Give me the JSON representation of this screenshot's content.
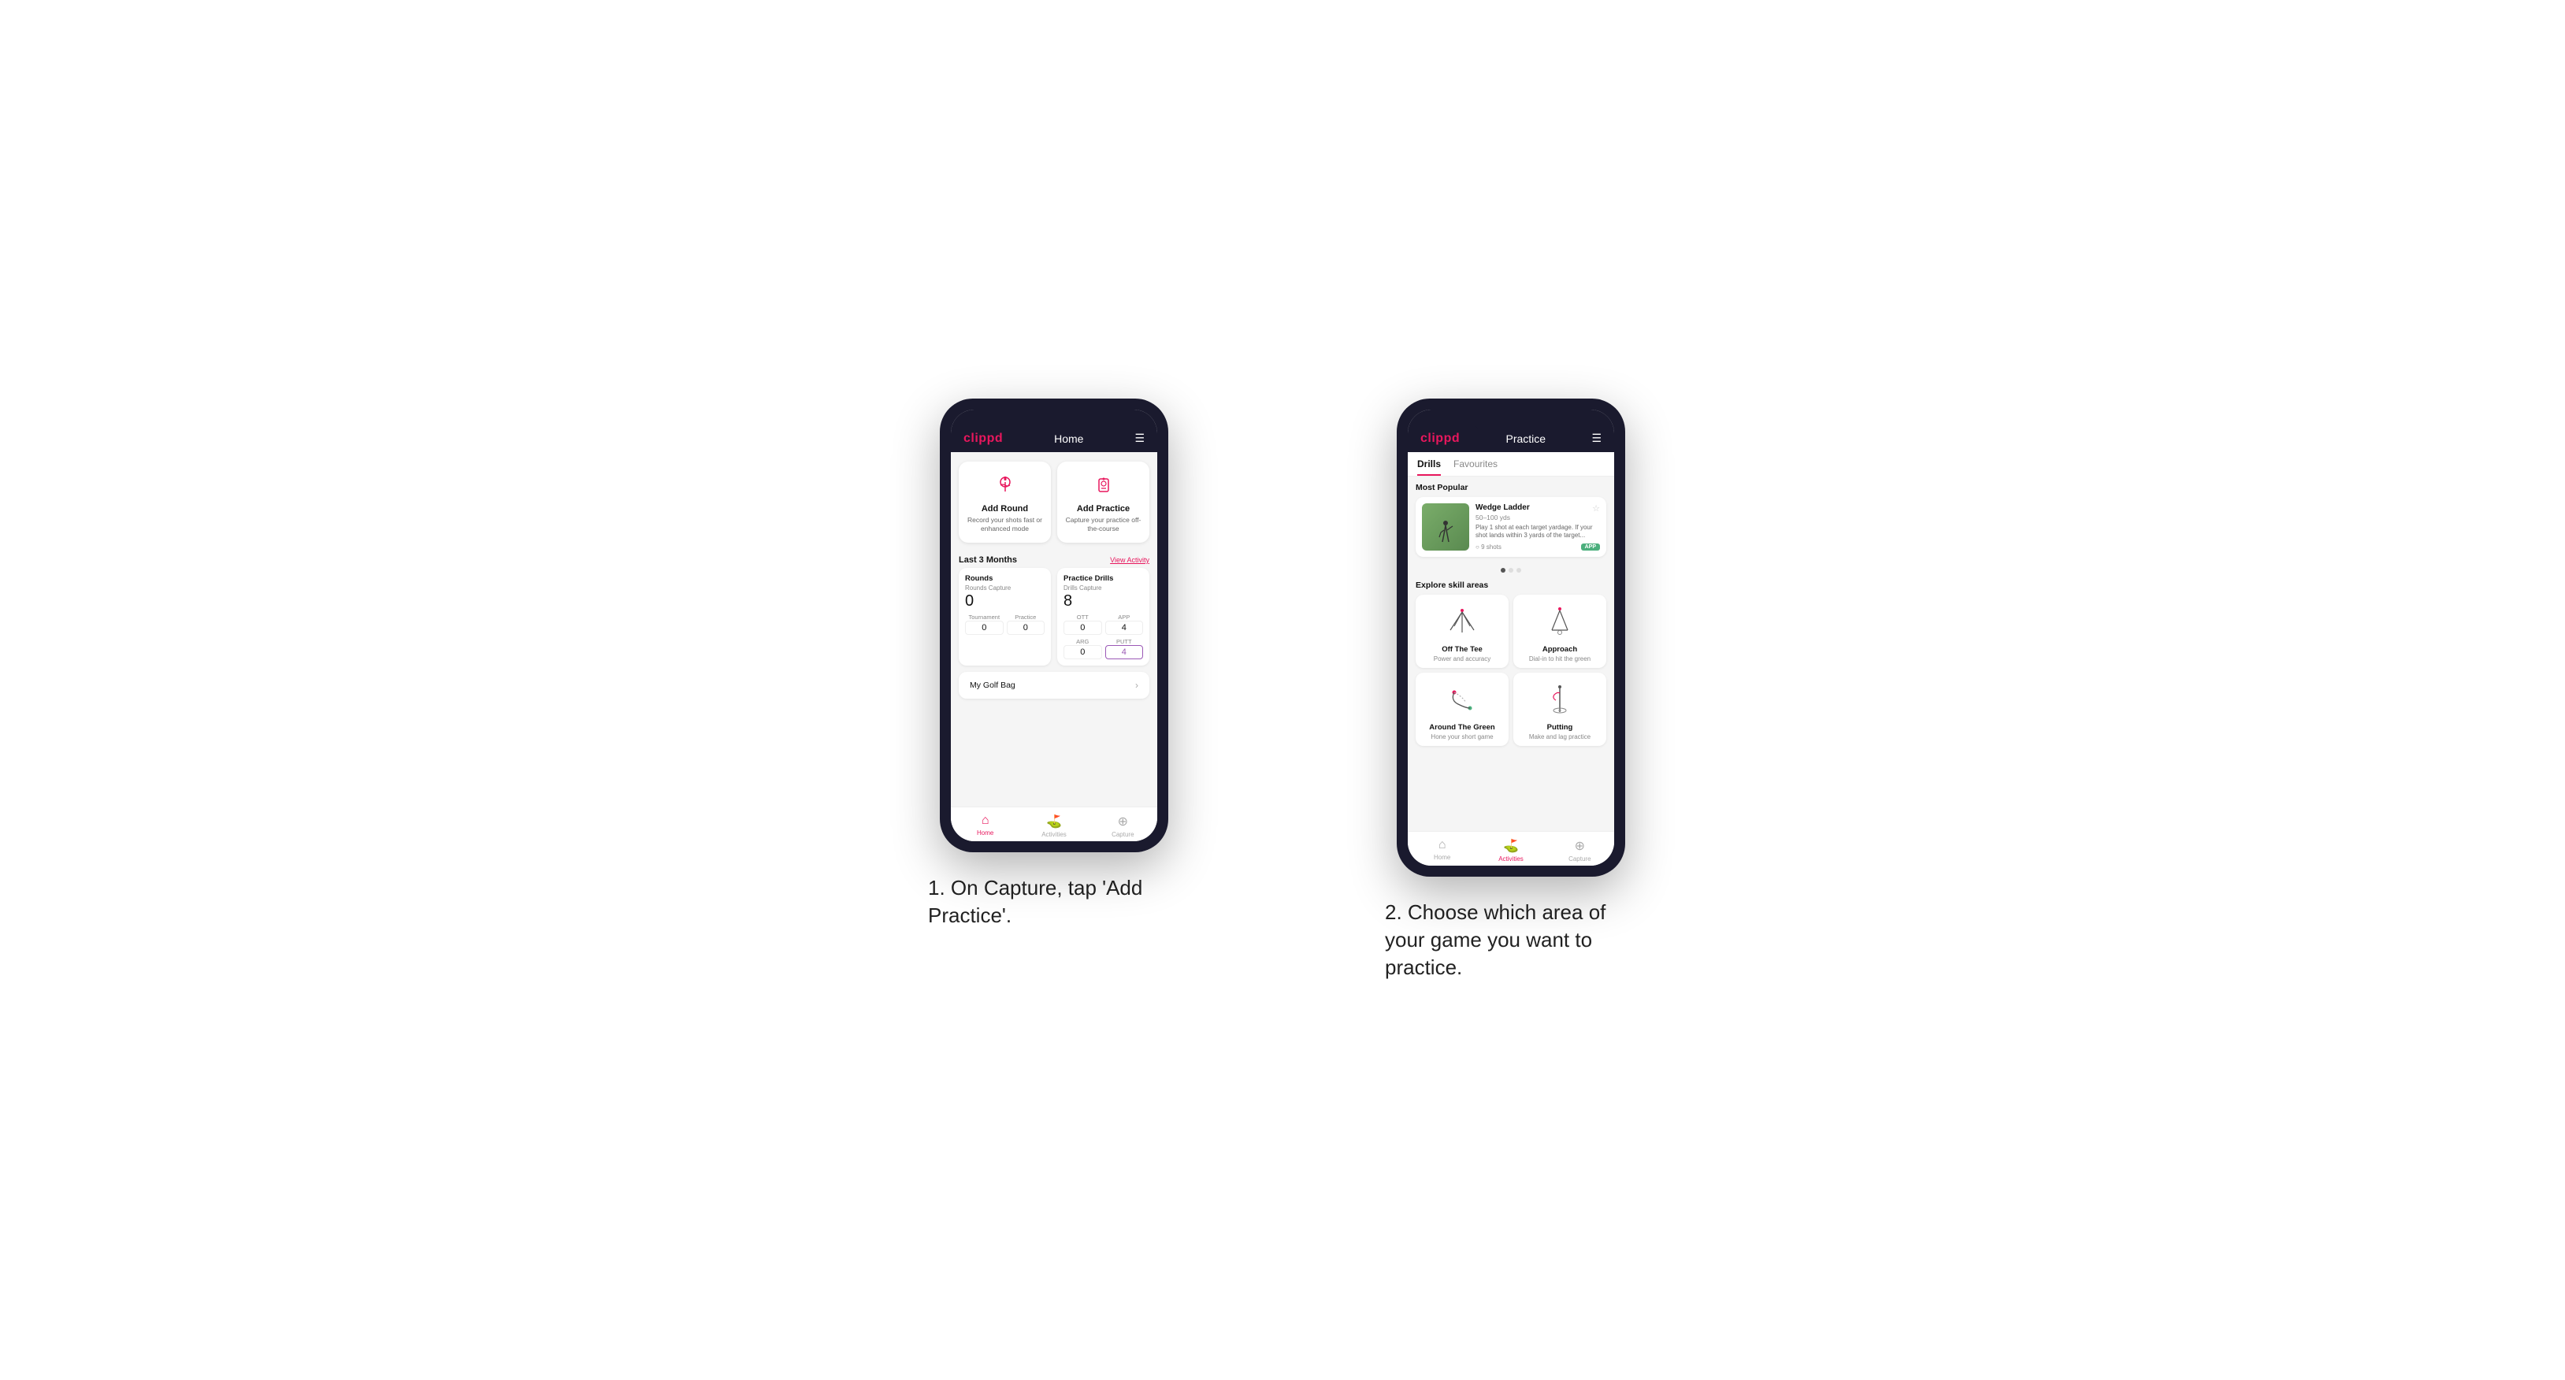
{
  "phone1": {
    "header": {
      "logo": "clippd",
      "title": "Home",
      "menu_icon": "☰"
    },
    "actions": [
      {
        "id": "add-round",
        "title": "Add Round",
        "desc": "Record your shots fast or enhanced mode"
      },
      {
        "id": "add-practice",
        "title": "Add Practice",
        "desc": "Capture your practice off-the-course"
      }
    ],
    "last3months": {
      "label": "Last 3 Months",
      "view_activity": "View Activity"
    },
    "rounds": {
      "title": "Rounds",
      "rounds_capture_label": "Rounds Capture",
      "rounds_capture_value": "0",
      "tournament_label": "Tournament",
      "tournament_value": "0",
      "practice_label": "Practice",
      "practice_value": "0"
    },
    "practice_drills": {
      "title": "Practice Drills",
      "drills_capture_label": "Drills Capture",
      "drills_capture_value": "8",
      "ott_label": "OTT",
      "ott_value": "0",
      "app_label": "APP",
      "app_value": "4",
      "arg_label": "ARG",
      "arg_value": "0",
      "putt_label": "PUTT",
      "putt_value": "4"
    },
    "golf_bag": {
      "label": "My Golf Bag"
    },
    "nav": [
      {
        "label": "Home",
        "active": true
      },
      {
        "label": "Activities",
        "active": false
      },
      {
        "label": "Capture",
        "active": false
      }
    ]
  },
  "phone2": {
    "header": {
      "logo": "clippd",
      "title": "Practice",
      "menu_icon": "☰"
    },
    "tabs": [
      {
        "label": "Drills",
        "active": true
      },
      {
        "label": "Favourites",
        "active": false
      }
    ],
    "most_popular": {
      "title": "Most Popular",
      "drill": {
        "name": "Wedge Ladder",
        "yardage": "50–100 yds",
        "desc": "Play 1 shot at each target yardage. If your shot lands within 3 yards of the target...",
        "shots": "9 shots",
        "badge": "APP"
      }
    },
    "explore_skill_areas": {
      "title": "Explore skill areas",
      "skills": [
        {
          "name": "Off The Tee",
          "desc": "Power and accuracy"
        },
        {
          "name": "Approach",
          "desc": "Dial-in to hit the green"
        },
        {
          "name": "Around The Green",
          "desc": "Hone your short game"
        },
        {
          "name": "Putting",
          "desc": "Make and lag practice"
        }
      ]
    },
    "nav": [
      {
        "label": "Home",
        "active": false
      },
      {
        "label": "Activities",
        "active": true
      },
      {
        "label": "Capture",
        "active": false
      }
    ]
  },
  "captions": {
    "step1": "1. On Capture, tap 'Add Practice'.",
    "step2": "2. Choose which area of your game you want to practice."
  },
  "colors": {
    "accent": "#e8175d",
    "bg": "#f5f5f5",
    "phone_frame": "#1a1a2e",
    "purple_highlight": "#9b59b6",
    "app_badge": "#4caf7d"
  }
}
